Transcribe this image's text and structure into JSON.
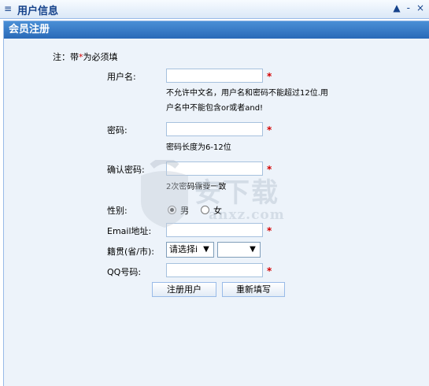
{
  "panel": {
    "collapse_glyph": "≡",
    "title": "用户信息",
    "tools": [
      "▲",
      "-",
      "×"
    ]
  },
  "form": {
    "title": "会员注册",
    "note_prefix": "注：带",
    "note_star": "*",
    "note_suffix": "为必须填",
    "username": {
      "label": "用户名:",
      "value": "",
      "hint_line1": "不允许中文名，用户名和密码不能超过12位.用",
      "hint_line2": "户名中不能包含or或者and!"
    },
    "password": {
      "label": "密码:",
      "value": "",
      "hint": "密码长度为6-12位"
    },
    "confirm": {
      "label": "确认密码:",
      "value": "",
      "hint": "2次密码需要一致"
    },
    "gender": {
      "label": "性别:",
      "option_male": "男",
      "option_female": "女",
      "selected": "男"
    },
    "email": {
      "label": "Email地址:",
      "value": ""
    },
    "origin": {
      "label": "籍贯(省/市):",
      "province_selected": "请选择i",
      "city_selected": ""
    },
    "qq": {
      "label": "QQ号码:",
      "value": ""
    },
    "required_star": "*",
    "buttons": {
      "submit": "注册用户",
      "reset": "重新填写"
    },
    "dropdown_glyph": "▼"
  },
  "watermark": {
    "brand": "安下载",
    "url": "anxz.com"
  },
  "colors": {
    "header_text": "#15428b",
    "form_title_bg": "#2a6ab8",
    "form_bg": "#edf3fa",
    "required": "#d40000"
  }
}
